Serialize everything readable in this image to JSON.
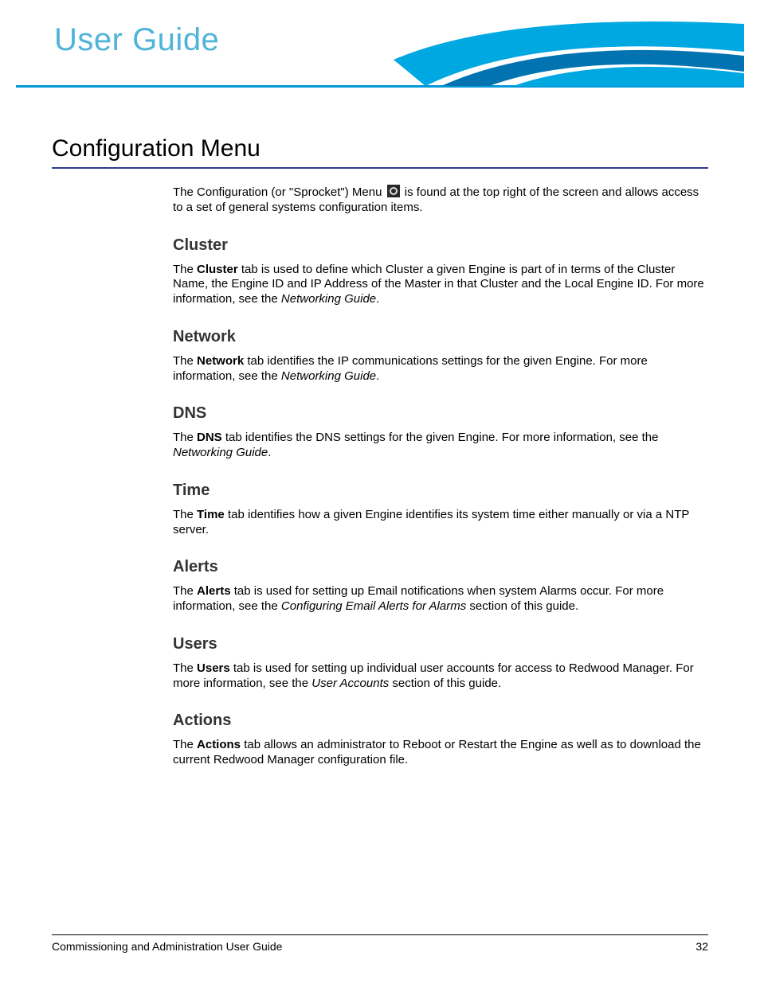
{
  "header": {
    "title": "User Guide"
  },
  "page": {
    "title": "Configuration Menu",
    "intro_before": "The Configuration (or \"Sprocket\") Menu ",
    "intro_after": " is found at the top right of the screen and allows access to a set of general systems configuration items."
  },
  "sections": [
    {
      "heading": "Cluster",
      "text_pre": "The ",
      "bold": "Cluster",
      "text_mid": " tab is used to define which Cluster a given Engine is part of in terms of the Cluster Name, the Engine ID and IP Address of the Master in that Cluster and the Local Engine ID. For more information, see the ",
      "ital": "Networking Guide",
      "text_post": "."
    },
    {
      "heading": "Network",
      "text_pre": "The ",
      "bold": "Network",
      "text_mid": " tab identifies the IP communications settings for the given Engine. For more information, see the ",
      "ital": "Networking Guide",
      "text_post": "."
    },
    {
      "heading": "DNS",
      "text_pre": "The ",
      "bold": "DNS",
      "text_mid": " tab identifies the DNS settings for the given Engine. For more information, see the ",
      "ital": "Networking Guide",
      "text_post": "."
    },
    {
      "heading": "Time",
      "text_pre": "The ",
      "bold": "Time",
      "text_mid": " tab identifies how a given Engine identifies its system time either manually or via a NTP server.",
      "ital": "",
      "text_post": ""
    },
    {
      "heading": "Alerts",
      "text_pre": "The ",
      "bold": "Alerts",
      "text_mid": " tab is used for setting up Email notifications when system Alarms occur. For more information, see the ",
      "ital": "Configuring Email Alerts for Alarms",
      "text_post": " section of this guide."
    },
    {
      "heading": "Users",
      "text_pre": "The ",
      "bold": "Users",
      "text_mid": " tab is used for setting up individual user accounts for access to Redwood Manager. For more information, see the ",
      "ital": "User Accounts",
      "text_post": " section of this guide."
    },
    {
      "heading": "Actions",
      "text_pre": "The ",
      "bold": "Actions",
      "text_mid": " tab allows an administrator to Reboot or Restart the Engine as well as to download the current Redwood Manager configuration file.",
      "ital": "",
      "text_post": ""
    }
  ],
  "footer": {
    "left": "Commissioning and Administration User Guide",
    "right": "32"
  }
}
